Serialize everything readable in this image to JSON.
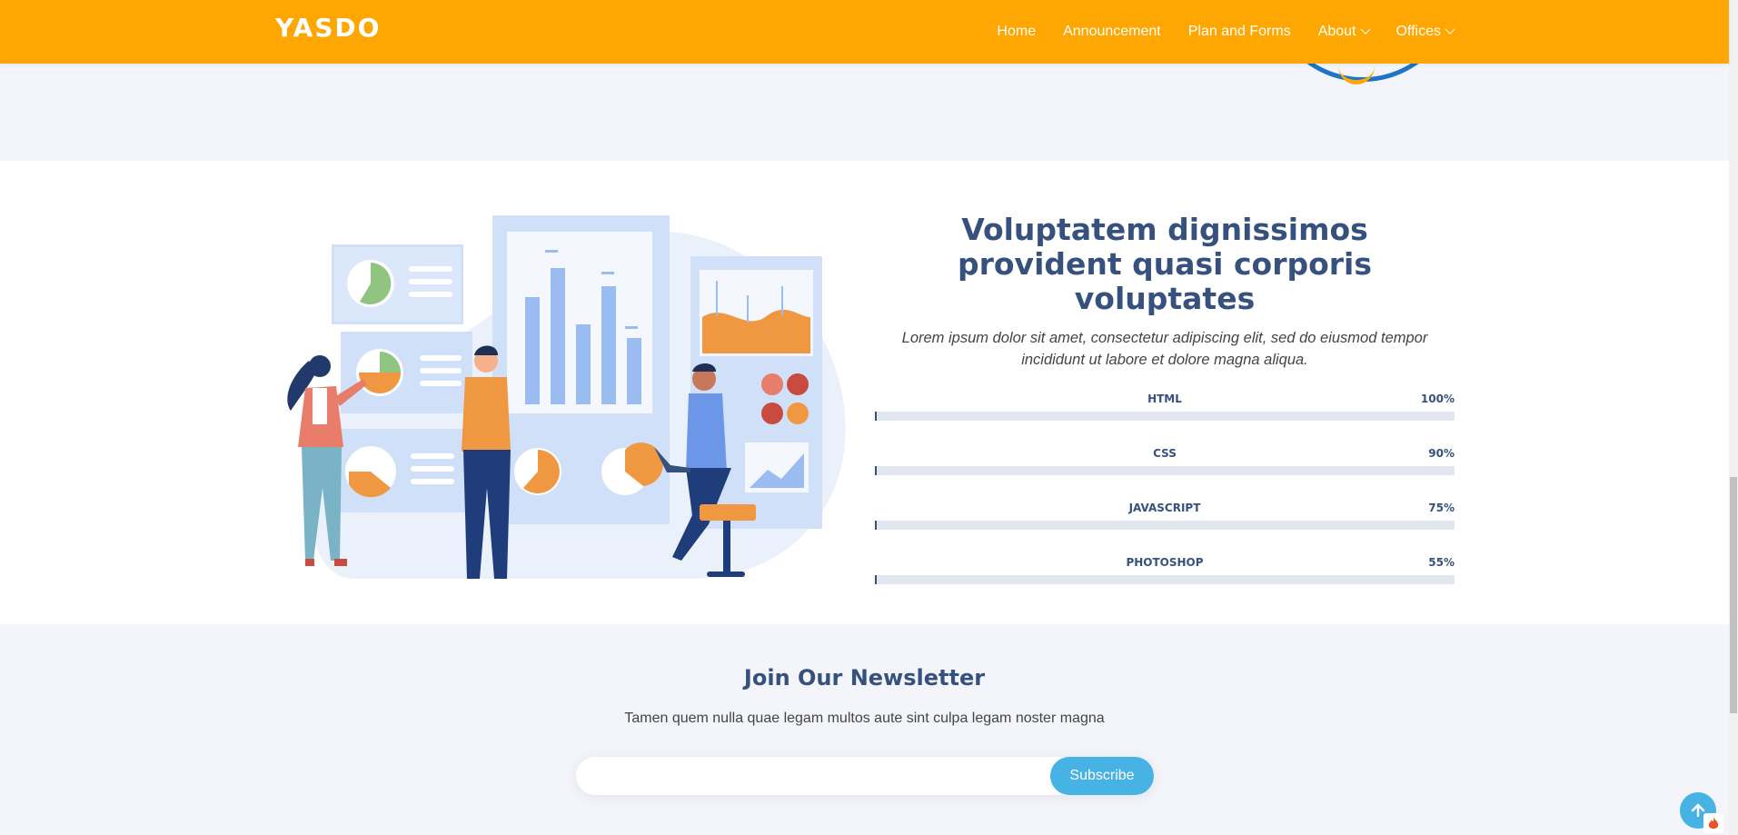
{
  "header": {
    "logo": "YASDO",
    "nav": [
      {
        "label": "Home",
        "dropdown": false
      },
      {
        "label": "Announcement",
        "dropdown": false
      },
      {
        "label": "Plan and Forms",
        "dropdown": false
      },
      {
        "label": "About",
        "dropdown": true
      },
      {
        "label": "Offices",
        "dropdown": true
      }
    ]
  },
  "skills": {
    "title": "Voluptatem dignissimos provident quasi corporis voluptates",
    "description": "Lorem ipsum dolor sit amet, consectetur adipiscing elit, sed do eiusmod tempor incididunt ut labore et dolore magna aliqua.",
    "items": [
      {
        "name": "HTML",
        "value": "100%"
      },
      {
        "name": "CSS",
        "value": "90%"
      },
      {
        "name": "JAVASCRIPT",
        "value": "75%"
      },
      {
        "name": "PHOTOSHOP",
        "value": "55%"
      }
    ]
  },
  "newsletter": {
    "title": "Join Our Newsletter",
    "text": "Tamen quem nulla quae legam multos aute sint culpa legam noster magna",
    "input_placeholder": "",
    "button_label": "Subscribe"
  },
  "colors": {
    "header_bg": "#fea602",
    "heading": "#37517e",
    "accent": "#47b2e4"
  },
  "icons": [
    "chevron-down-icon",
    "arrow-up-icon",
    "fire-icon"
  ]
}
